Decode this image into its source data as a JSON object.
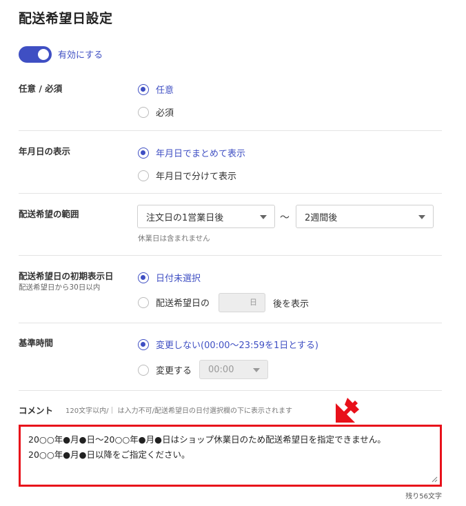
{
  "title": "配送希望日設定",
  "toggle": {
    "label": "有効にする",
    "on": true,
    "accent": "#3f4fc3"
  },
  "required": {
    "label": "任意 / 必須",
    "options": [
      {
        "label": "任意",
        "checked": true
      },
      {
        "label": "必須",
        "checked": false
      }
    ]
  },
  "date_display": {
    "label": "年月日の表示",
    "options": [
      {
        "label": "年月日でまとめて表示",
        "checked": true
      },
      {
        "label": "年月日で分けて表示",
        "checked": false
      }
    ]
  },
  "range": {
    "label": "配送希望の範囲",
    "start_value": "注文日の1営業日後",
    "separator": "～",
    "end_value": "2週間後",
    "note": "休業日は含まれません"
  },
  "initial_date": {
    "label": "配送希望日の初期表示日",
    "sub_label": "配送希望日から30日以内",
    "options": [
      {
        "label": "日付未選択",
        "checked": true
      },
      {
        "label": "配送希望日の",
        "checked": false
      }
    ],
    "day_unit": "日",
    "after_text": "後を表示"
  },
  "base_time": {
    "label": "基準時間",
    "options": [
      {
        "label": "変更しない(00:00～23:59を1日とする)",
        "checked": true
      },
      {
        "label": "変更する",
        "checked": false
      }
    ],
    "time_value": "00:00"
  },
  "comment": {
    "label": "コメント",
    "hint": "120文字以内/｜ は入力不可/配送希望日の日付選択欄の下に表示されます",
    "value": "20○○年●月●日～20○○年●月●日はショップ休業日のため配送希望日を指定できません。\n20○○年●月●日以降をご指定ください。",
    "remaining": "残り56文字",
    "highlight_color": "#e8101a"
  }
}
